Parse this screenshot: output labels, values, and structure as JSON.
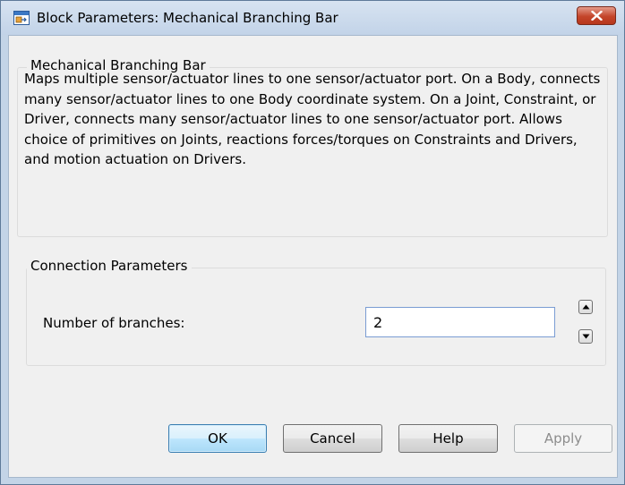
{
  "window": {
    "title": "Block Parameters: Mechanical Branching Bar",
    "close_label": "×"
  },
  "description_group": {
    "label": "Mechanical Branching Bar",
    "text": "Maps multiple sensor/actuator lines to one sensor/actuator port. On a Body, connects many sensor/actuator lines to one Body coordinate system. On a Joint, Constraint, or Driver, connects many sensor/actuator lines to one sensor/actuator port. Allows choice of primitives on Joints, reactions forces/torques on Constraints and Drivers, and motion actuation on Drivers."
  },
  "parameters_group": {
    "label": "Connection Parameters",
    "number_of_branches_label": "Number of branches:",
    "number_of_branches_value": "2"
  },
  "buttons": {
    "ok": "OK",
    "cancel": "Cancel",
    "help": "Help",
    "apply": "Apply"
  },
  "icons": {
    "app": "simulink-block-icon",
    "close": "close-icon",
    "spin_up": "arrow-up-icon",
    "spin_down": "arrow-down-icon"
  },
  "colors": {
    "titlebar": "#c2d3e8",
    "close_button": "#c4452a",
    "dialog_background": "#f0f0f0",
    "default_button_border": "#3c7fb1"
  }
}
